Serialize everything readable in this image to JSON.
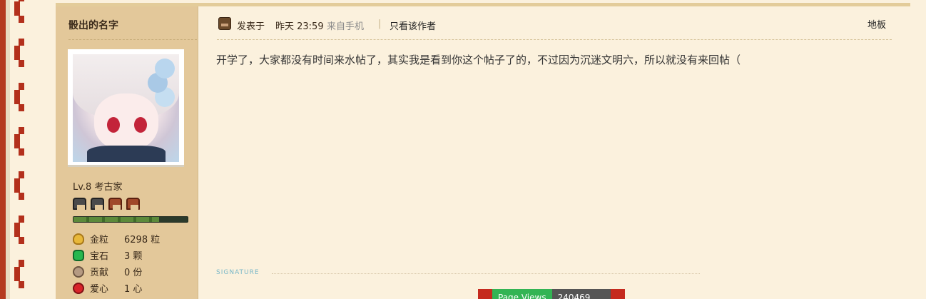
{
  "sidebar": {
    "username": "骰出的名字",
    "level": "Lv.8 考古家",
    "exp_fraction": 0.75,
    "stats": [
      {
        "icon": "gold-nugget-icon",
        "label": "金粒",
        "value": "6298 粒"
      },
      {
        "icon": "emerald-icon",
        "label": "宝石",
        "value": "3 颗"
      },
      {
        "icon": "contribution-icon",
        "label": "贡献",
        "value": "0 份"
      },
      {
        "icon": "apple-heart-icon",
        "label": "爱心",
        "value": "1 心"
      }
    ]
  },
  "post": {
    "posted_label": "发表于",
    "posted_time": "昨天 23:59",
    "from": "来自手机",
    "separator": "|",
    "only_author": "只看该作者",
    "floor": "地板",
    "content": "开学了，大家都没有时间来水帖了，其实我是看到你这个帖子了的，不过因为沉迷文明六，所以就没有来回帖（"
  },
  "signature": {
    "label": "SIGNATURE"
  },
  "page_views": {
    "label": "Page Views",
    "count": "240469"
  },
  "colors": {
    "sidebar_bg": "#e3c89a",
    "content_bg": "#fbf1dd",
    "accent_red": "#b3301c",
    "pv_green": "#33b454"
  }
}
